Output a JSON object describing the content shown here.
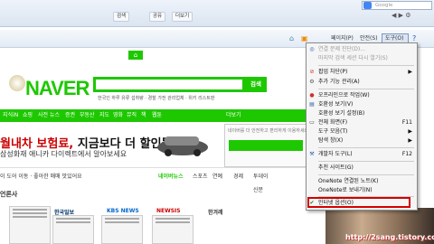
{
  "browser": {
    "top_buttons": [
      "검색",
      "공유",
      "더보기"
    ],
    "google_placeholder": "Google",
    "command_bar": {
      "page": "페이지(P)",
      "safety": "안전(S)",
      "tools": "도구(O)",
      "help_icon": "help-icon"
    }
  },
  "naver": {
    "logo": "NAVER",
    "hint": "한국인 하루 유류 섭취량 · 경찰 가전 관리업체 · 위키 리스트판",
    "search_btn": "검색",
    "search_sub_text": "· 위키문  |  · 배경",
    "nav": [
      "지식iN",
      "쇼핑",
      "사전",
      "뉴스",
      "증권",
      "부동산",
      "지도",
      "영화",
      "뮤직",
      "책",
      "웹툰",
      "더보기"
    ],
    "ad_title_red": "월내차 보험료,",
    "ad_title_black": " 지금보다 더 할인될까?",
    "ad_sub": "삼성화재 애니카 다이렉트에서 알아보세요",
    "login_hint": "네이버를 더 안전하고 편리하게 이용하세요",
    "left_caption": "이 도어 이동 · 좋아한 매매 맛있어요",
    "section_tabs": [
      "네이버뉴스",
      "스포츠",
      "연예",
      "경제"
    ],
    "left_label": "언론사",
    "news_logos": [
      "한국일보",
      "KBS NEWS",
      "NEWSIS",
      "한겨레"
    ],
    "right_items": [
      "투데이",
      "신문"
    ]
  },
  "menu": {
    "items": [
      {
        "label": "연결 문제 진단(D)...",
        "shortcut": "",
        "arrow": false,
        "disabled": true
      },
      {
        "label": "마지막 검색 세션 다시 열기(S)",
        "shortcut": "",
        "arrow": false,
        "disabled": true
      },
      {
        "label": "팝업 차단(P)",
        "shortcut": "",
        "arrow": true,
        "disabled": false
      },
      {
        "label": "추가 기능 관리(A)",
        "shortcut": "",
        "arrow": false,
        "disabled": false
      },
      {
        "label": "오프라인으로 작업(W)",
        "shortcut": "",
        "arrow": false,
        "disabled": false
      },
      {
        "label": "호환성 보기(V)",
        "shortcut": "",
        "arrow": false,
        "disabled": false
      },
      {
        "label": "호환성 보기 설정(B)",
        "shortcut": "",
        "arrow": false,
        "disabled": false
      },
      {
        "label": "전체 화면(F)",
        "shortcut": "F11",
        "arrow": false,
        "disabled": false
      },
      {
        "label": "도구 모음(T)",
        "shortcut": "",
        "arrow": true,
        "disabled": false
      },
      {
        "label": "탐색 창(X)",
        "shortcut": "",
        "arrow": true,
        "disabled": false
      },
      {
        "label": "개발자 도구(L)",
        "shortcut": "F12",
        "arrow": false,
        "disabled": false
      },
      {
        "label": "추천 사이트(G)",
        "shortcut": "",
        "arrow": false,
        "disabled": false
      },
      {
        "label": "OneNote 연결된 노트(K)",
        "shortcut": "",
        "arrow": false,
        "disabled": false
      },
      {
        "label": "OneNote로 보내기(N)",
        "shortcut": "",
        "arrow": false,
        "disabled": false
      },
      {
        "label": "인터넷 옵션(O)",
        "shortcut": "",
        "arrow": false,
        "disabled": false
      }
    ]
  },
  "watermark": "http://2sang.tistory.com/",
  "colors": {
    "naver_green": "#1ec800",
    "highlight": "#d40000"
  }
}
